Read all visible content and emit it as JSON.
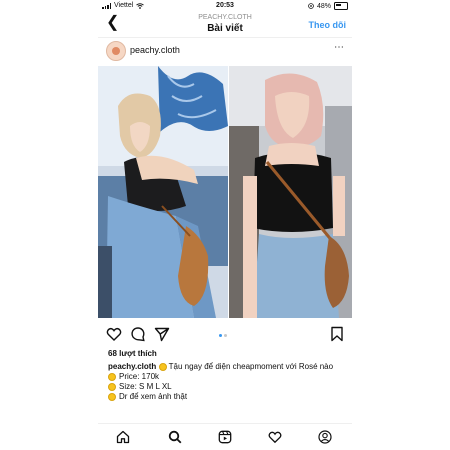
{
  "status": {
    "carrier": "Viettel",
    "time": "20:53",
    "battery": "48%"
  },
  "header": {
    "account": "PEACHY.CLOTH",
    "title": "Bài viết",
    "follow_label": "Theo dõi"
  },
  "post": {
    "username": "peachy.cloth",
    "likes": "68 lượt thích",
    "caption": {
      "username": "peachy.cloth",
      "text": "Tậu ngay để diện cheapmoment với Rosé nào",
      "price": "Price: 170k",
      "size": "Size: S M L XL",
      "dm": "Dr để xem ảnh thật"
    },
    "carousel": {
      "count": 2,
      "active_index": 0
    }
  },
  "colors": {
    "accent": "#3897f0",
    "text": "#111111",
    "muted": "#8e8e8e"
  }
}
